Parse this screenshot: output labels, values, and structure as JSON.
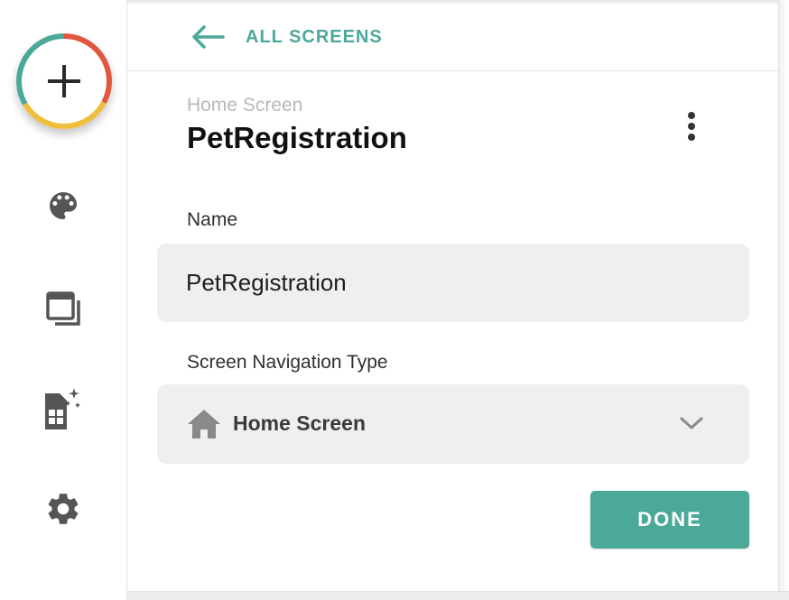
{
  "nav": {
    "back_label": "ALL SCREENS"
  },
  "screen": {
    "type_label": "Home Screen",
    "title": "PetRegistration"
  },
  "form": {
    "name_label": "Name",
    "name_value": "PetRegistration",
    "nav_type_label": "Screen Navigation Type",
    "nav_type_value": "Home Screen",
    "done_label": "DONE"
  },
  "sidebar": {
    "items": [
      {
        "icon": "add-icon"
      },
      {
        "icon": "palette-icon"
      },
      {
        "icon": "screens-icon"
      },
      {
        "icon": "data-sheet-icon"
      },
      {
        "icon": "gear-icon"
      }
    ]
  },
  "colors": {
    "accent": "#4ba99a",
    "ring_red": "#e0563f",
    "ring_yellow": "#eebf3c",
    "field_bg": "#efefef"
  }
}
